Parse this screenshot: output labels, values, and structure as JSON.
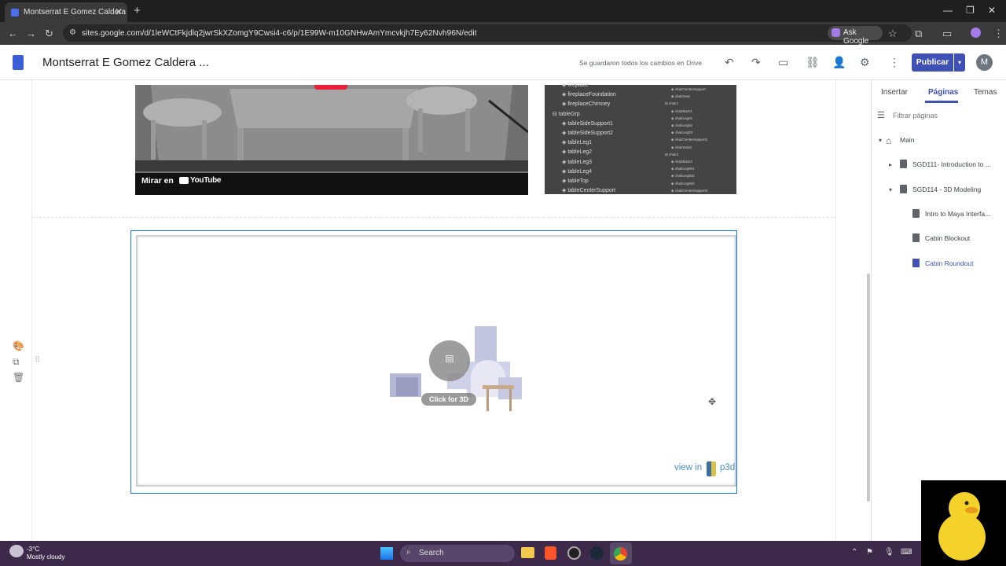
{
  "browser": {
    "tab_title": "Montserrat E Gomez Caldera Po",
    "url": "sites.google.com/d/1leWCtFkjdlq2jwrSkXZomgY9Cwsi4-c6/p/1E99W-m10GNHwAmYmcvkjh7Ey62Nvh96N/edit",
    "ask_google": "Ask Google"
  },
  "sites": {
    "title": "Montserrat E Gomez Caldera ...",
    "saved_status": "Se guardaron todos los cambios en Drive",
    "publish_label": "Publicar",
    "avatar_initial": "M"
  },
  "video": {
    "watch_on": "Mirar en",
    "youtube": "YouTube"
  },
  "outliner": {
    "left_items": [
      "fireplace",
      "fireplaceFoundation",
      "fireplaceChimney",
      "tableGrp",
      "tableSideSupport1",
      "tableSideSupport2",
      "tableLeg1",
      "tableLeg2",
      "tableLeg3",
      "tableLeg4",
      "tableTop",
      "tableCenterSupport"
    ],
    "right_items": [
      "chairCenterSupport",
      "chairSeat",
      "chair1",
      "chairBack1",
      "chairLeg01",
      "chairLeg02",
      "chairLeg03",
      "chairCenterSupport1",
      "chairSeat1",
      "chair2",
      "chairBack2",
      "chairLeg001",
      "chairLeg002",
      "chairLeg003",
      "chairCenterSupport2"
    ]
  },
  "embed": {
    "click_label": "Click for 3D",
    "view_in": "view in",
    "brand": "p3d"
  },
  "panel": {
    "tabs": [
      "Insertar",
      "Páginas",
      "Temas"
    ],
    "filter_placeholder": "Filtrar páginas",
    "pages": [
      {
        "label": "Main",
        "level": 0
      },
      {
        "label": "SGD111- Introduction to ...",
        "level": 1
      },
      {
        "label": "SGD114 - 3D Modeling",
        "level": 1
      },
      {
        "label": "Intro to Maya Interfa...",
        "level": 2
      },
      {
        "label": "Cabin Blockout",
        "level": 2
      },
      {
        "label": "Cabin Roundout",
        "level": 2,
        "selected": true
      }
    ]
  },
  "taskbar": {
    "temperature": "-3°C",
    "weather": "Mostly cloudy",
    "search": "Search"
  },
  "colors": {
    "accent": "#3f51b5",
    "link": "#1a73e8",
    "taskbar": "#3d2a4a"
  }
}
